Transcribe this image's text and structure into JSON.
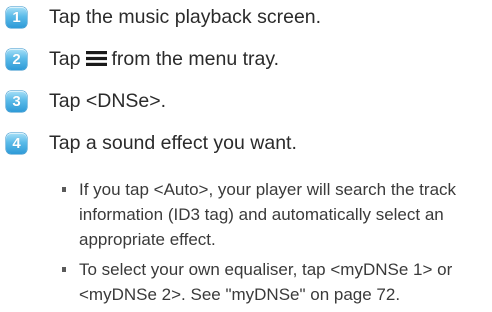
{
  "steps": [
    {
      "number": "1",
      "text": "Tap the music playback screen."
    },
    {
      "number": "2",
      "text_before": "Tap",
      "icon": "menu-icon",
      "text_after": "from the menu tray."
    },
    {
      "number": "3",
      "text": "Tap <DNSe>."
    },
    {
      "number": "4",
      "text": "Tap a sound effect you want."
    }
  ],
  "bullets": [
    {
      "line1": "If you tap <Auto>, your player will search the track",
      "line2": "information (ID3 tag) and automatically select an",
      "line3": "appropriate effect."
    },
    {
      "line1": "To select your own equaliser, tap <myDNSe 1> or",
      "line2": "<myDNSe 2>. See \"myDNSe\" on page 72."
    }
  ],
  "colors": {
    "badge": "#3aa6df",
    "text": "#2b2b2b"
  }
}
